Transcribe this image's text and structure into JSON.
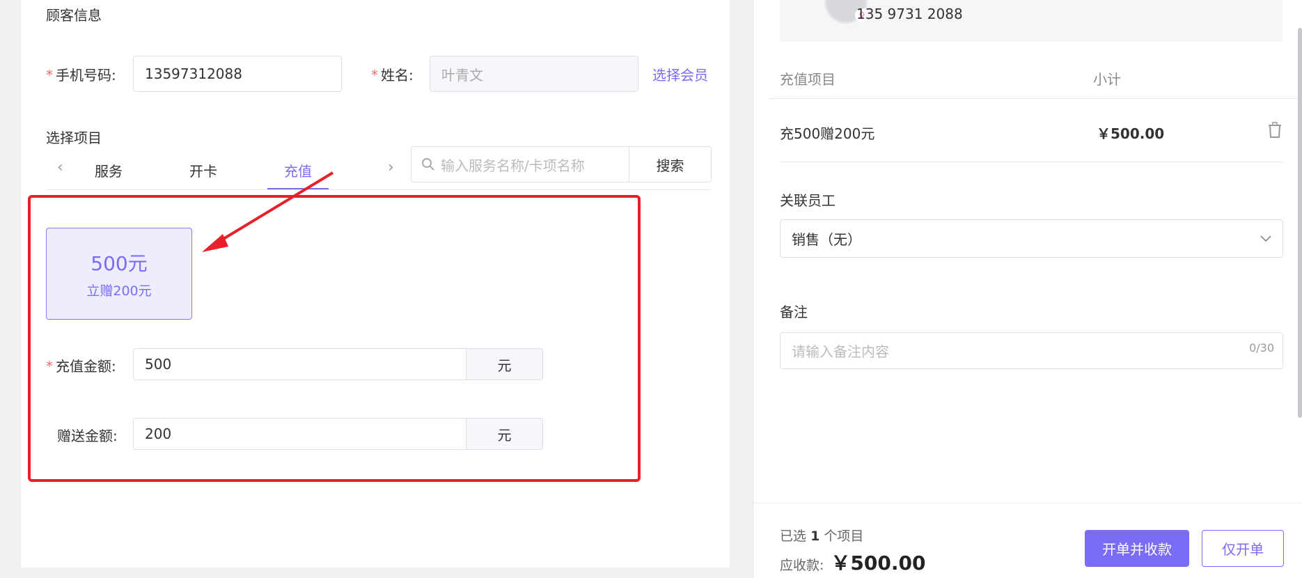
{
  "customer": {
    "section_title": "顾客信息",
    "phone_label": "手机号码:",
    "phone_value": "13597312088",
    "name_label": "姓名:",
    "name_placeholder": "叶青文",
    "select_member_link": "选择会员"
  },
  "items": {
    "section_title": "选择项目",
    "tabs": [
      {
        "label": "服务",
        "active": false
      },
      {
        "label": "开卡",
        "active": false
      },
      {
        "label": "充值",
        "active": true
      }
    ],
    "search_placeholder": "输入服务名称/卡项名称",
    "search_button": "搜索"
  },
  "recharge": {
    "card_amount": "500元",
    "card_gift": "立赠200元",
    "amount_label": "充值金额:",
    "amount_value": "500",
    "amount_unit": "元",
    "gift_label": "赠送金额:",
    "gift_value": "200",
    "gift_unit": "元"
  },
  "member": {
    "phone": "135 9731 2088"
  },
  "order": {
    "col_item": "充值项目",
    "col_subtotal": "小计",
    "rows": [
      {
        "name": "充500赠200元",
        "subtotal": "￥500.00"
      }
    ],
    "staff_label": "关联员工",
    "staff_value": "销售（无）",
    "note_label": "备注",
    "note_placeholder": "请输入备注内容",
    "note_counter": "0/30"
  },
  "footer": {
    "selected_prefix": "已选",
    "selected_count": "1",
    "selected_suffix": "个项目",
    "due_label": "应收款:",
    "due_amount": "￥500.00",
    "pay_button": "开单并收款",
    "order_only_button": "仅开单"
  },
  "colors": {
    "accent": "#7b6cf6",
    "highlight_red": "#e8202a",
    "required": "#f56c6c"
  }
}
